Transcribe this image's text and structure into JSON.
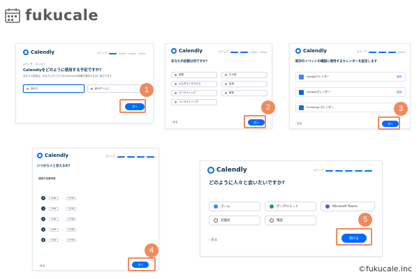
{
  "brand": {
    "name": "fukucale"
  },
  "copyright": "©fukucale.inc",
  "colors": {
    "accent": "#006bff",
    "highlight": "#f08a5d",
    "navy": "#0b3558"
  },
  "common": {
    "app_logo": "Calendly",
    "step_label": "ステップ",
    "back": "戻る",
    "next": "次へ"
  },
  "steps": [
    {
      "num": "1",
      "greeting": "ようこそ、スッペー",
      "question": "Calendlyをどのように使用する予定ですか?",
      "sub": "あなたの回答は、あなたにぴったりのCalendlyの体験を提供するのに役立ちます",
      "options": [
        "自分で",
        "私のチームと"
      ],
      "button": "次へ"
    },
    {
      "num": "2",
      "question": "あなたの役割は何ですか?",
      "sub": "",
      "options": [
        "営業",
        "マーケティング",
        "カスタマーサクセス",
        "採用",
        "コンサルティング",
        "教育",
        "その他"
      ],
      "button": "次へ"
    },
    {
      "num": "3",
      "question": "既存のイベントの確認に使用するカレンダーを設定します",
      "calendars": [
        "Googleカレンダー",
        "Outlookカレンダー",
        "Exchange カレンダー"
      ],
      "toggle": "接続",
      "button": "次へ"
    },
    {
      "num": "4",
      "question": "いつから人と会えるの?",
      "sub": "",
      "section": "週間の営業時間",
      "days": [
        "月",
        "火",
        "水",
        "木",
        "金"
      ],
      "start": "9:00",
      "end": "17:00",
      "dash": "-",
      "button": "次へ"
    },
    {
      "num": "5",
      "question": "どのように人々と会いたいですか?",
      "sub": "",
      "options": [
        "ズーム",
        "グーグルミート",
        "Microsoft Teams",
        "対面式",
        "電話"
      ],
      "button": "続ける"
    }
  ]
}
